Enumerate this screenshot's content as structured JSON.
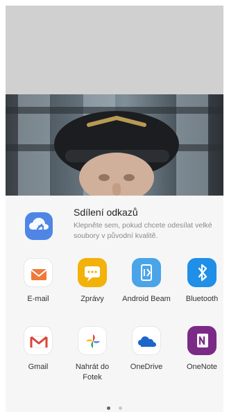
{
  "share_sheet": {
    "link_share": {
      "title": "Sdílení odkazů",
      "description": "Klepněte sem, pokud chcete odesílat velké soubory v původní kvalitě."
    },
    "apps": [
      {
        "label": "E-mail",
        "icon": "email-icon",
        "color": "#f07a3a"
      },
      {
        "label": "Zprávy",
        "icon": "messages-icon",
        "color": "#f2b10b"
      },
      {
        "label": "Android Beam",
        "icon": "android-beam-icon",
        "color": "#4aa4e8"
      },
      {
        "label": "Bluetooth",
        "icon": "bluetooth-icon",
        "color": "#1f8fe8"
      },
      {
        "label": "Gmail",
        "icon": "gmail-icon",
        "color": "#ffffff"
      },
      {
        "label": "Nahrát do Fotek",
        "icon": "google-photos-icon",
        "color": "#ffffff"
      },
      {
        "label": "OneDrive",
        "icon": "onedrive-icon",
        "color": "#ffffff"
      },
      {
        "label": "OneNote",
        "icon": "onenote-icon",
        "color": "#7b2a86"
      }
    ],
    "page_indicator": {
      "pages": 2,
      "current": 1
    }
  }
}
